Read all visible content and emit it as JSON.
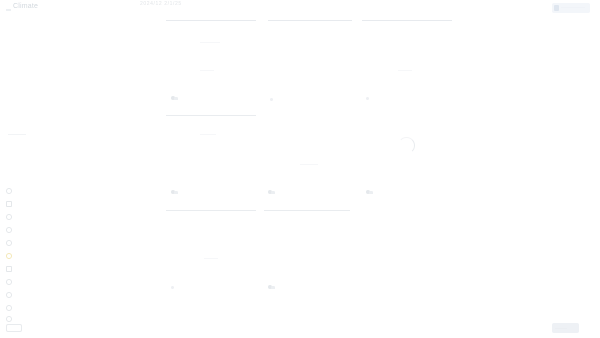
{
  "header": {
    "logo": "Climate",
    "date_range": "2024/12   2/1/25",
    "action_label": "——————"
  },
  "sidebar": {
    "items": [
      {
        "icon": "circle-icon"
      },
      {
        "icon": "square-icon"
      },
      {
        "icon": "circle-icon"
      },
      {
        "icon": "circle-icon"
      },
      {
        "icon": "circle-icon"
      },
      {
        "icon": "circle-icon",
        "color": "#f4e8b8"
      },
      {
        "icon": "square-icon"
      },
      {
        "icon": "circle-icon"
      },
      {
        "icon": "circle-icon"
      },
      {
        "icon": "circle-icon"
      },
      {
        "icon": "circle-icon"
      }
    ]
  },
  "footer": {
    "button_label": "———"
  }
}
